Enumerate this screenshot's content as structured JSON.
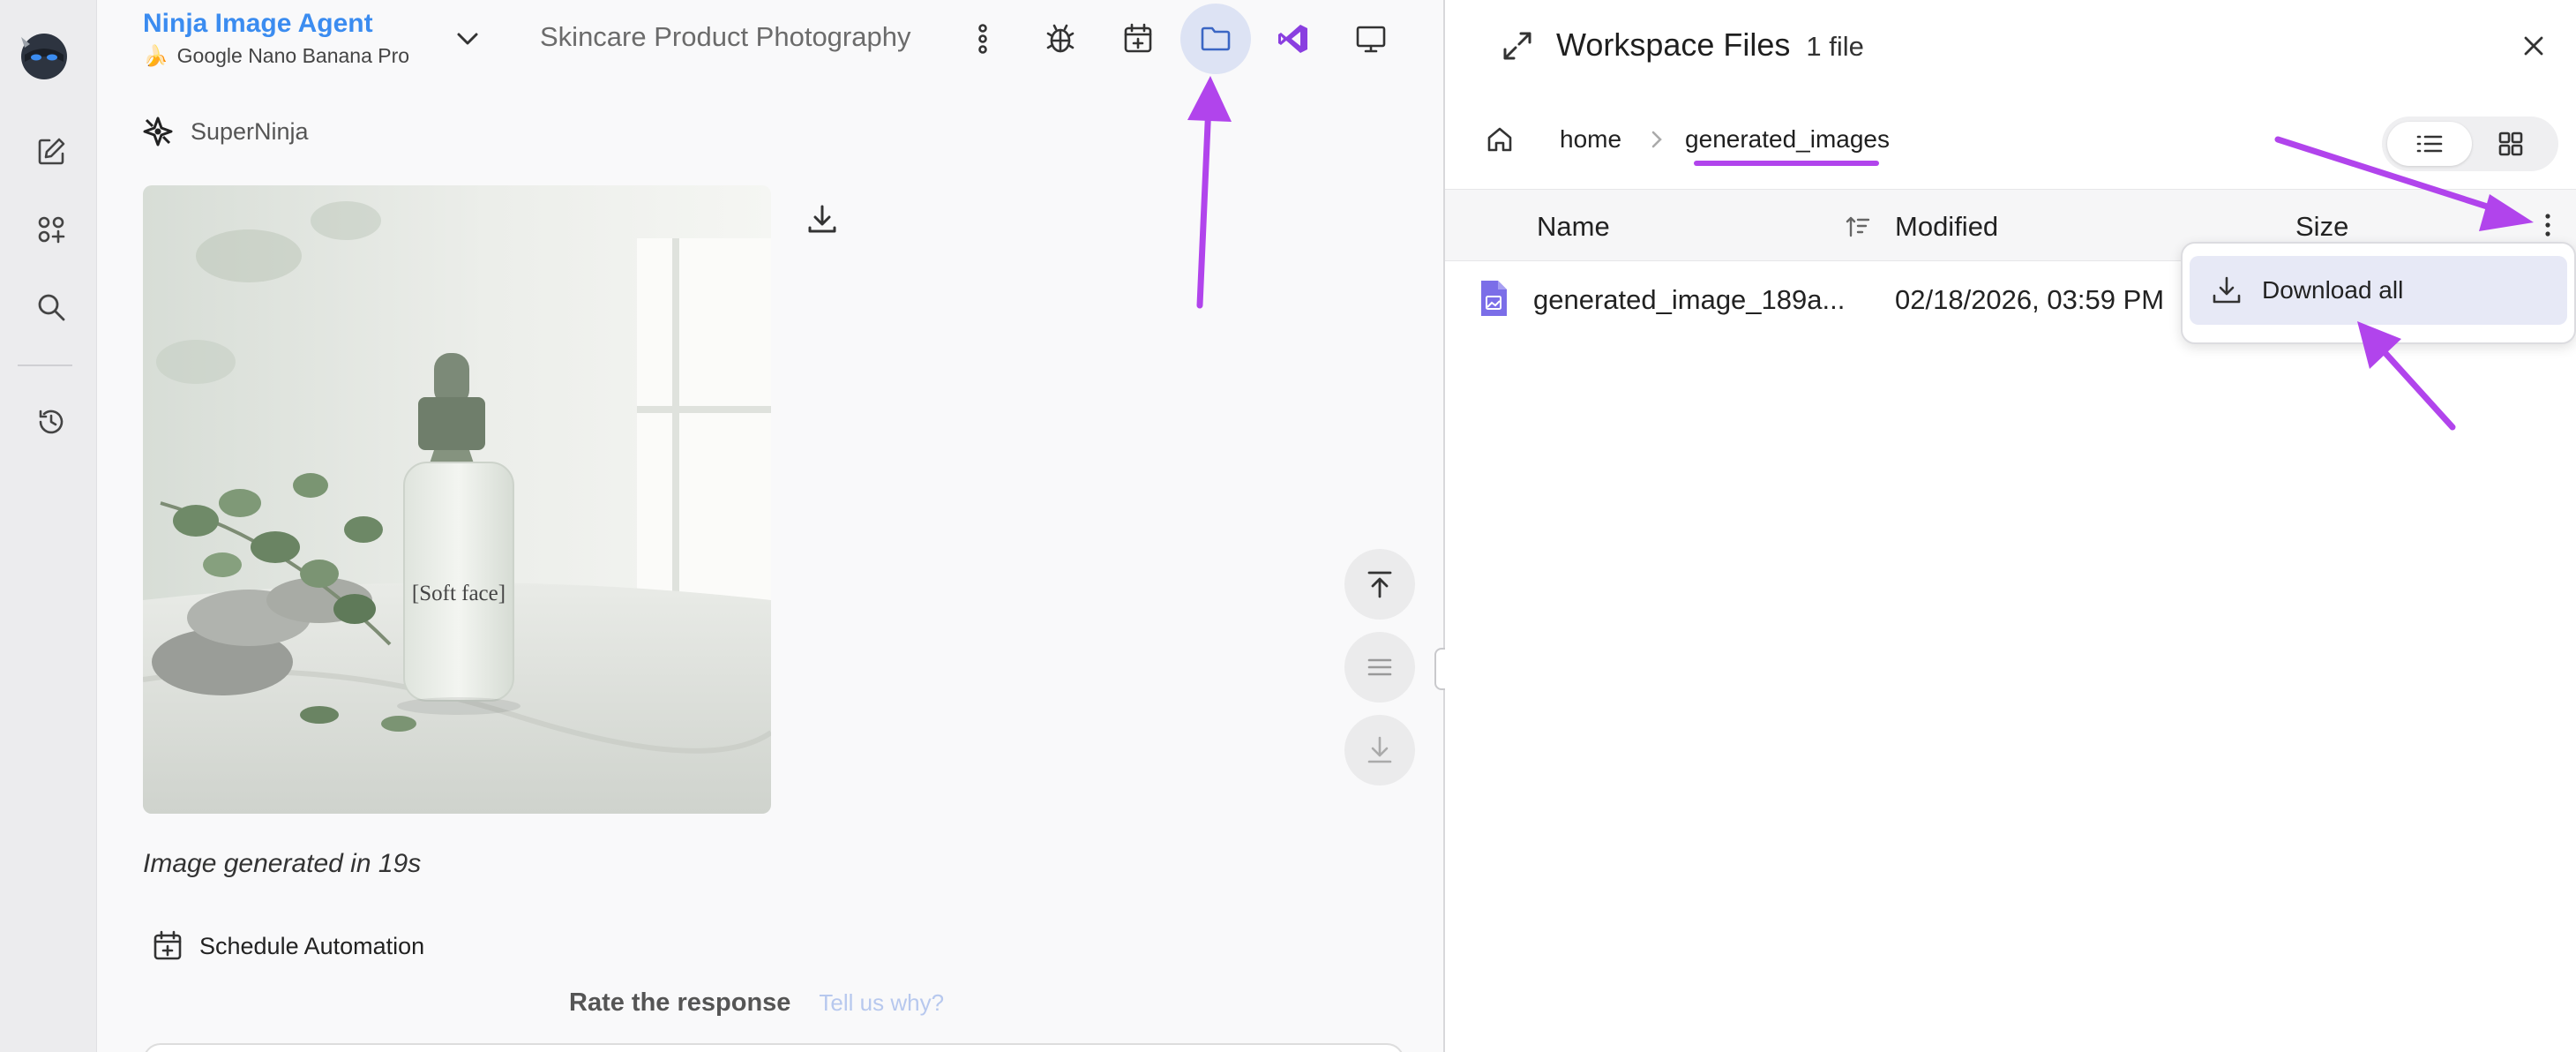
{
  "colors": {
    "accent_blue": "#3b8cf0",
    "annotation_purple": "#b144ec",
    "active_tool_bg": "#dde3f4",
    "vs_purple": "#8a3fe0"
  },
  "rail": {
    "icons": [
      "ninja-logo-icon",
      "new-chat-icon",
      "apps-icon",
      "search-icon",
      "history-icon"
    ]
  },
  "header": {
    "agent_name": "Ninja Image Agent",
    "model_emoji": "🍌",
    "model_name": "Google Nano Banana Pro",
    "chat_title": "Skincare Product Photography",
    "tools": [
      "more-vertical-icon",
      "bug-icon",
      "calendar-add-icon",
      "folder-icon",
      "vscode-icon",
      "monitor-icon"
    ],
    "active_tool": "folder-icon"
  },
  "message": {
    "author": "SuperNinja",
    "bottle_label": "[Soft face]",
    "caption": "Image generated in 19s",
    "schedule_label": "Schedule Automation",
    "rate_label": "Rate the response",
    "tell_us": "Tell us why?"
  },
  "files_panel": {
    "title": "Workspace Files",
    "count": "1 file",
    "breadcrumbs": [
      "home",
      "generated_images"
    ],
    "columns": {
      "name": "Name",
      "modified": "Modified",
      "size": "Size"
    },
    "rows": [
      {
        "name": "generated_image_189a...",
        "modified": "02/18/2026, 03:59 PM"
      }
    ],
    "menu": {
      "download_all": "Download all"
    },
    "view_mode": "list"
  }
}
